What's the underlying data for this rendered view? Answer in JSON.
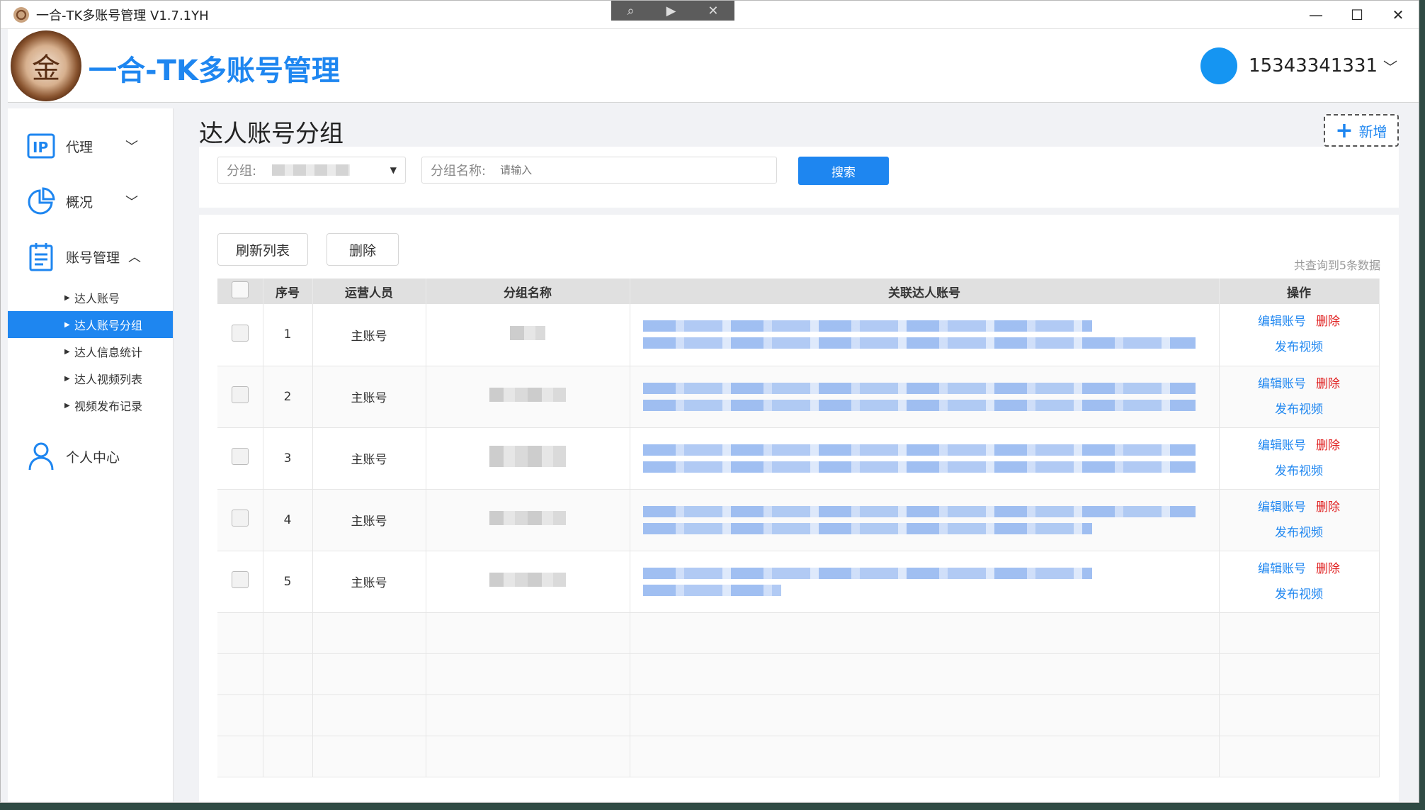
{
  "window": {
    "title": "一合-TK多账号管理 V1.7.1YH",
    "controls": {
      "minimize": "—",
      "maximize": "☐",
      "close": "✕"
    },
    "overlay_icons": [
      "search-icon",
      "play-icon",
      "close-icon"
    ]
  },
  "header": {
    "logo_glyph": "金",
    "brand_name": "一合-TK多账号管理",
    "user_phone": "15343341331"
  },
  "sidebar": {
    "items": [
      {
        "label": "代理",
        "icon": "ip-icon"
      },
      {
        "label": "概况",
        "icon": "pie-chart-icon"
      },
      {
        "label": "账号管理",
        "icon": "clipboard-icon"
      },
      {
        "label": "个人中心",
        "icon": "user-icon"
      }
    ],
    "subitems": [
      {
        "label": "达人账号"
      },
      {
        "label": "达人账号分组"
      },
      {
        "label": "达人信息统计"
      },
      {
        "label": "达人视频列表"
      },
      {
        "label": "视频发布记录"
      }
    ],
    "ip_badge": "IP"
  },
  "main": {
    "page_title": "达人账号分组",
    "add_button": "新增",
    "filter": {
      "group_label": "分组:",
      "group_name_label": "分组名称:",
      "group_name_placeholder": "请输入",
      "search_button": "搜索"
    },
    "toolbar": {
      "refresh_button": "刷新列表",
      "delete_button": "删除",
      "total_text": "共查询到5条数据"
    },
    "table": {
      "columns": [
        "序号",
        "运营人员",
        "分组名称",
        "关联达人账号",
        "操作"
      ],
      "rows": [
        {
          "index": "1",
          "operator": "主账号"
        },
        {
          "index": "2",
          "operator": "主账号"
        },
        {
          "index": "3",
          "operator": "主账号"
        },
        {
          "index": "4",
          "operator": "主账号"
        },
        {
          "index": "5",
          "operator": "主账号"
        }
      ],
      "actions": {
        "edit": "编辑账号",
        "delete": "删除",
        "publish": "发布视频"
      }
    }
  },
  "colors": {
    "accent": "#1e86f0",
    "danger": "#e02020",
    "avatar": "#1595f2"
  }
}
